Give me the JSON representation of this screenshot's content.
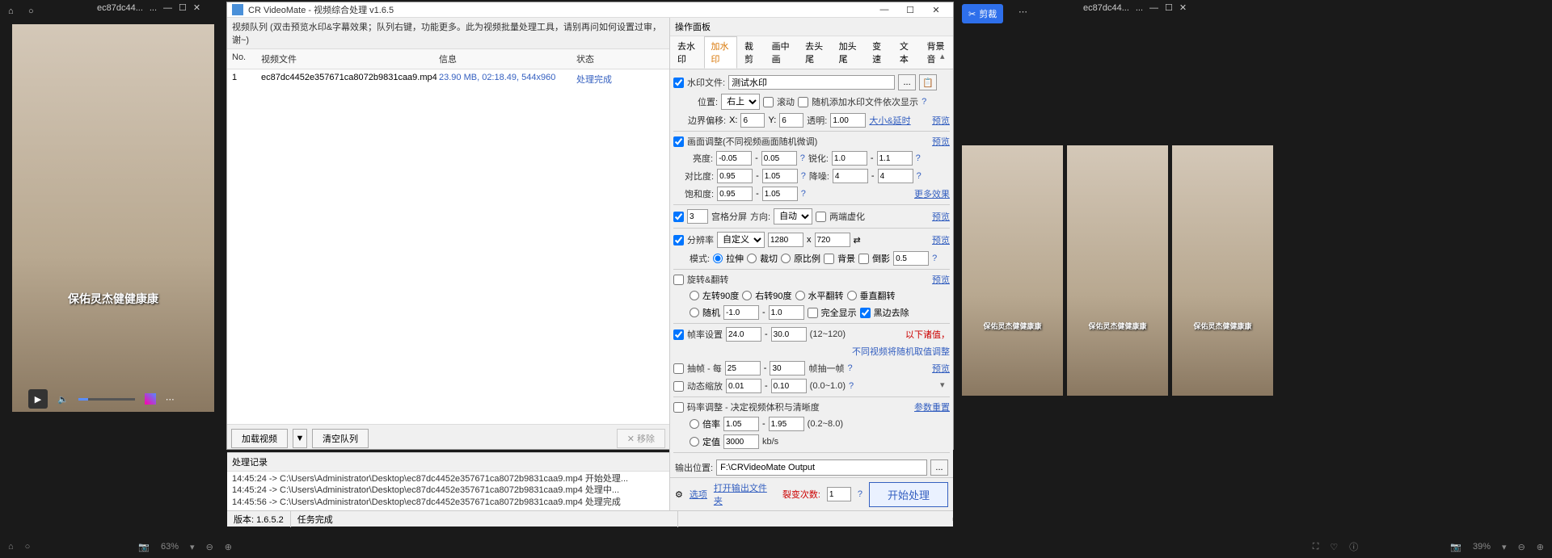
{
  "bg": {
    "tab_label": "ec87dc44...",
    "cut_label": "剪裁",
    "subtitle": "保佑灵杰健健康康",
    "zoom_left": "63%",
    "zoom_right": "39%"
  },
  "window": {
    "title": "CR VideoMate - 视频综合处理 v1.6.5",
    "queue_title": "视频队列 (双击预览水印&字幕效果；队列右键，功能更多。此为视频批量处理工具，请别再问如何设置过审，谢~)",
    "columns": {
      "no": "No.",
      "file": "视频文件",
      "info": "信息",
      "status": "状态"
    },
    "rows": [
      {
        "no": "1",
        "file": "ec87dc4452e357671ca8072b9831caa9.mp4",
        "info": "23.90 MB, 02:18.49, 544x960",
        "status": "处理完成"
      }
    ],
    "btn_load": "加载视频",
    "btn_clear": "清空队列",
    "btn_move": "✕ 移除",
    "log_title": "处理记录",
    "logs": [
      "14:45:24 -> C:\\Users\\Administrator\\Desktop\\ec87dc4452e357671ca8072b9831caa9.mp4 开始处理...",
      "14:45:24 -> C:\\Users\\Administrator\\Desktop\\ec87dc4452e357671ca8072b9831caa9.mp4 处理中...",
      "14:45:56 -> C:\\Users\\Administrator\\Desktop\\ec87dc4452e357671ca8072b9831caa9.mp4 处理完成"
    ],
    "panel_title": "操作面板",
    "tabs": [
      "去水印",
      "加水印",
      "裁剪",
      "画中画",
      "去头尾",
      "加头尾",
      "变速",
      "文本",
      "背景音"
    ],
    "active_tab": 1,
    "wm": {
      "file_label": "水印文件:",
      "file_val": "测试水印",
      "pos_label": "位置:",
      "pos_val": "右上",
      "scroll": "滚动",
      "random": "随机添加水印文件依次显示",
      "offset_label": "边界偏移:",
      "x": "6",
      "y": "6",
      "trans_label": "透明:",
      "trans": "1.00",
      "size_link": "大小&延时",
      "preview": "预览"
    },
    "adj": {
      "title": "画面调整(不同视频画面随机微调)",
      "bright": "亮度:",
      "b1": "-0.05",
      "b2": "0.05",
      "sharp": "锐化:",
      "s1": "1.0",
      "s2": "1.1",
      "contrast": "对比度:",
      "c1": "0.95",
      "c2": "1.05",
      "noise": "降噪:",
      "n1": "4",
      "n2": "4",
      "sat": "饱和度:",
      "sa1": "0.95",
      "sa2": "1.05",
      "more": "更多效果"
    },
    "grid": {
      "val": "3",
      "label": "宫格分屏",
      "dir": "方向:",
      "dir_val": "自动",
      "blur": "两端虚化"
    },
    "res": {
      "label": "分辨率",
      "mode": "自定义",
      "w": "1280",
      "h": "720",
      "mode_label": "模式:",
      "stretch": "拉伸",
      "crop": "裁切",
      "ratio": "原比例",
      "bg": "背景",
      "mirror": "倒影",
      "mirror_val": "0.5"
    },
    "rot": {
      "label": "旋转&翻转",
      "l90": "左转90度",
      "r90": "右转90度",
      "hflip": "水平翻转",
      "vflip": "垂直翻转",
      "rand": "随机",
      "r1": "-1.0",
      "r2": "1.0",
      "full": "完全显示",
      "black": "黑边去除"
    },
    "fps": {
      "label": "帧率设置",
      "f1": "24.0",
      "f2": "30.0",
      "range": "(12~120)",
      "note": "以下诸值，",
      "note2": "不同视频将随机取值调整"
    },
    "drop": {
      "label": "抽帧 - 每",
      "d1": "25",
      "d2": "30",
      "unit": "帧抽一帧"
    },
    "zoom": {
      "label": "动态缩放",
      "z1": "0.01",
      "z2": "0.10",
      "range": "(0.0~1.0)"
    },
    "br": {
      "label": "码率调整 - 决定视频体积与清晰度",
      "mult": "倍率",
      "m1": "1.05",
      "m2": "1.95",
      "range": "(0.2~8.0)",
      "fixed": "定值",
      "fv": "3000",
      "unit": "kb/s",
      "reset": "参数重置"
    },
    "output": {
      "label": "输出位置:",
      "path": "F:\\CRVideoMate Output"
    },
    "footer": {
      "opts": "选项",
      "open": "打开输出文件夹",
      "fission": "裂变次数:",
      "fv": "1",
      "start": "开始处理"
    },
    "status": {
      "ver": "版本: 1.6.5.2",
      "task": "任务完成"
    }
  }
}
